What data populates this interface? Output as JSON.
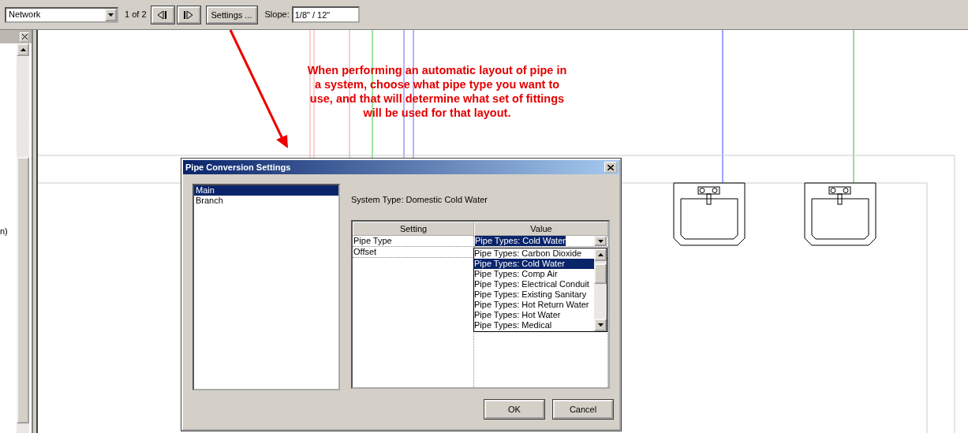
{
  "toolbar": {
    "view_select": "Network",
    "page_indicator": "1 of 2",
    "settings_button": "Settings ...",
    "slope_label": "Slope:",
    "slope_value": "1/8\" / 12\""
  },
  "left_panel": {
    "cut_text": "n)"
  },
  "annotation": "When performing an automatic layout of pipe in a system, choose what pipe type you want to use, and that will determine what set of fittings will be used for that layout.",
  "dialog": {
    "title": "Pipe Conversion Settings",
    "categories": [
      {
        "label": "Main",
        "selected": true
      },
      {
        "label": "Branch",
        "selected": false
      }
    ],
    "system_type": "System Type: Domestic Cold Water",
    "columns": [
      "Setting",
      "Value"
    ],
    "rows": [
      {
        "setting": "Pipe Type",
        "value": "Pipe Types: Cold Water"
      },
      {
        "setting": "Offset"
      }
    ],
    "dropdown_options": [
      {
        "label": "Pipe Types: Carbon Dioxide",
        "selected": false
      },
      {
        "label": "Pipe Types: Cold Water",
        "selected": true
      },
      {
        "label": "Pipe Types: Comp Air",
        "selected": false
      },
      {
        "label": "Pipe Types: Electrical Conduit",
        "selected": false
      },
      {
        "label": "Pipe Types: Existing Sanitary",
        "selected": false
      },
      {
        "label": "Pipe Types: Hot Return Water",
        "selected": false
      },
      {
        "label": "Pipe Types: Hot Water",
        "selected": false
      },
      {
        "label": "Pipe Types: Medical",
        "selected": false
      }
    ],
    "buttons": [
      "OK",
      "Cancel"
    ]
  }
}
